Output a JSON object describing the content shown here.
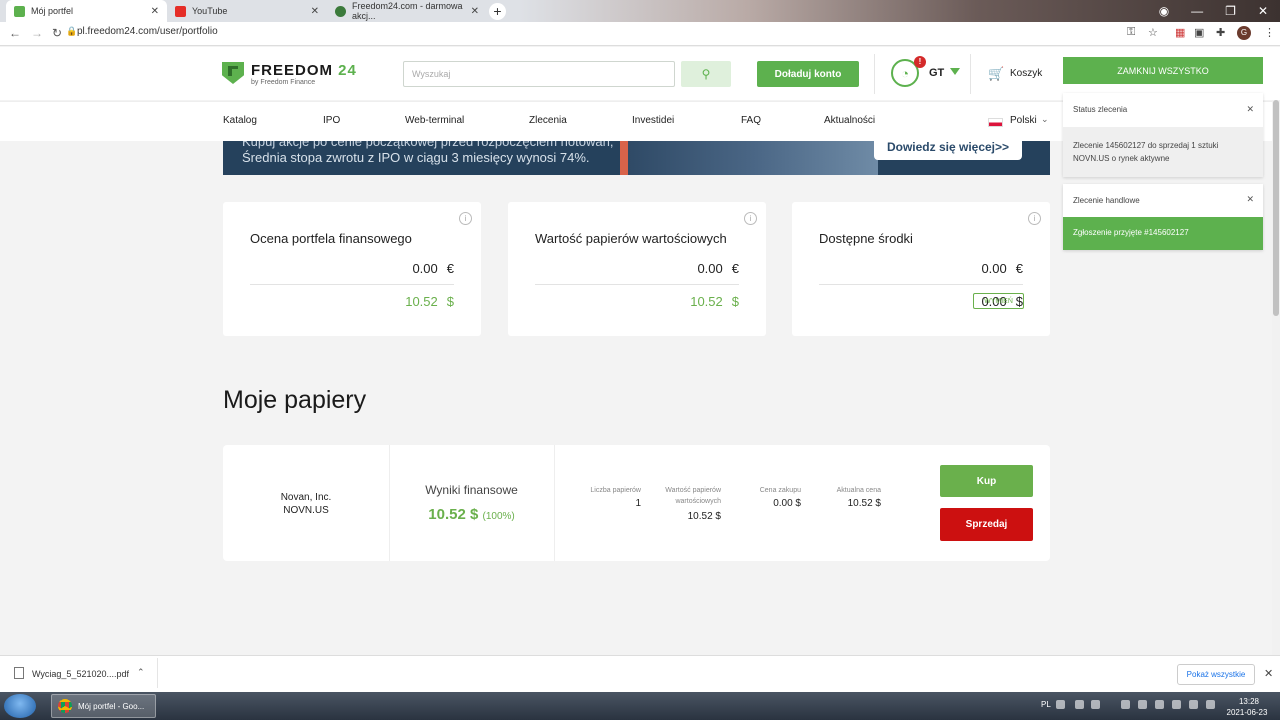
{
  "browser": {
    "tabs": [
      {
        "title": "Mój portfel"
      },
      {
        "title": "YouTube"
      },
      {
        "title": "Freedom24.com - darmowa akcj..."
      }
    ],
    "url": "pl.freedom24.com/user/portfolio"
  },
  "header": {
    "logo_main": "FREEDOM",
    "logo_num": "24",
    "logo_sub": "by Freedom Finance",
    "search_placeholder": "Wyszukaj",
    "topup_label": "Doładuj konto",
    "user_initials": "GT",
    "notification_count": "!",
    "cart_label": "Koszyk"
  },
  "menu": {
    "items": [
      "Katalog",
      "IPO",
      "Web-terminal",
      "Zlecenia",
      "Investidei",
      "FAQ",
      "Aktualności"
    ],
    "language": "Polski"
  },
  "banner": {
    "line1": "Kupuj akcje po cenie początkowej przed rozpoczęciem notowań,",
    "line2": "Średnia stopa zwrotu z IPO w ciągu 3 miesięcy wynosi 74%.",
    "cta": "Dowiedz się więcej>>"
  },
  "cards": [
    {
      "title": "Ocena portfela finansowego",
      "eur_value": "0.00",
      "eur_symbol": "€",
      "usd_value": "10.52",
      "usd_symbol": "$"
    },
    {
      "title": "Wartość papierów wartościowych",
      "eur_value": "0.00",
      "eur_symbol": "€",
      "usd_value": "10.52",
      "usd_symbol": "$"
    },
    {
      "title": "Dostępne środki",
      "eur_value": "0.00",
      "eur_symbol": "€",
      "usd_value": "0.00",
      "usd_symbol": "$",
      "exchange_label": "WYMIEŃ"
    }
  ],
  "portfolio": {
    "section_title": "Moje papiery",
    "holding": {
      "company": "Novan, Inc.",
      "ticker": "NOVN.US",
      "results_label": "Wyniki finansowe",
      "results_value": "10.52 $",
      "results_pct": "(100%)",
      "qty_label": "Liczba papierów",
      "qty_value": "1",
      "value_label_1": "Wartość papierów",
      "value_label_2": "wartościowych",
      "value_value": "10.52 $",
      "buy_price_label": "Cena zakupu",
      "buy_price_value": "0.00 $",
      "current_price_label": "Aktualna cena",
      "current_price_value": "10.52 $",
      "buy_label": "Kup",
      "sell_label": "Sprzedaj"
    }
  },
  "notifications": {
    "close_all_label": "ZAMKNIJ WSZYSTKO",
    "items": [
      {
        "header": "Status zlecenia",
        "body": "Zlecenie 145602127 do sprzedaj 1 sztuki NOVN.US o rynek aktywne"
      },
      {
        "header": "Zlecenie handlowe",
        "body": "Zgłoszenie przyjęte #145602127"
      }
    ]
  },
  "downloads": {
    "file_name": "Wyciag_5_521020....pdf",
    "show_all_label": "Pokaż wszystkie"
  },
  "taskbar": {
    "app_label": "Mój portfel - Goo...",
    "lang": "PL",
    "time": "13:28",
    "date": "2021-06-23"
  },
  "colors": {
    "brand_green": "#5db14e",
    "sell_red": "#cc1010",
    "banner_blue": "#25415c"
  }
}
